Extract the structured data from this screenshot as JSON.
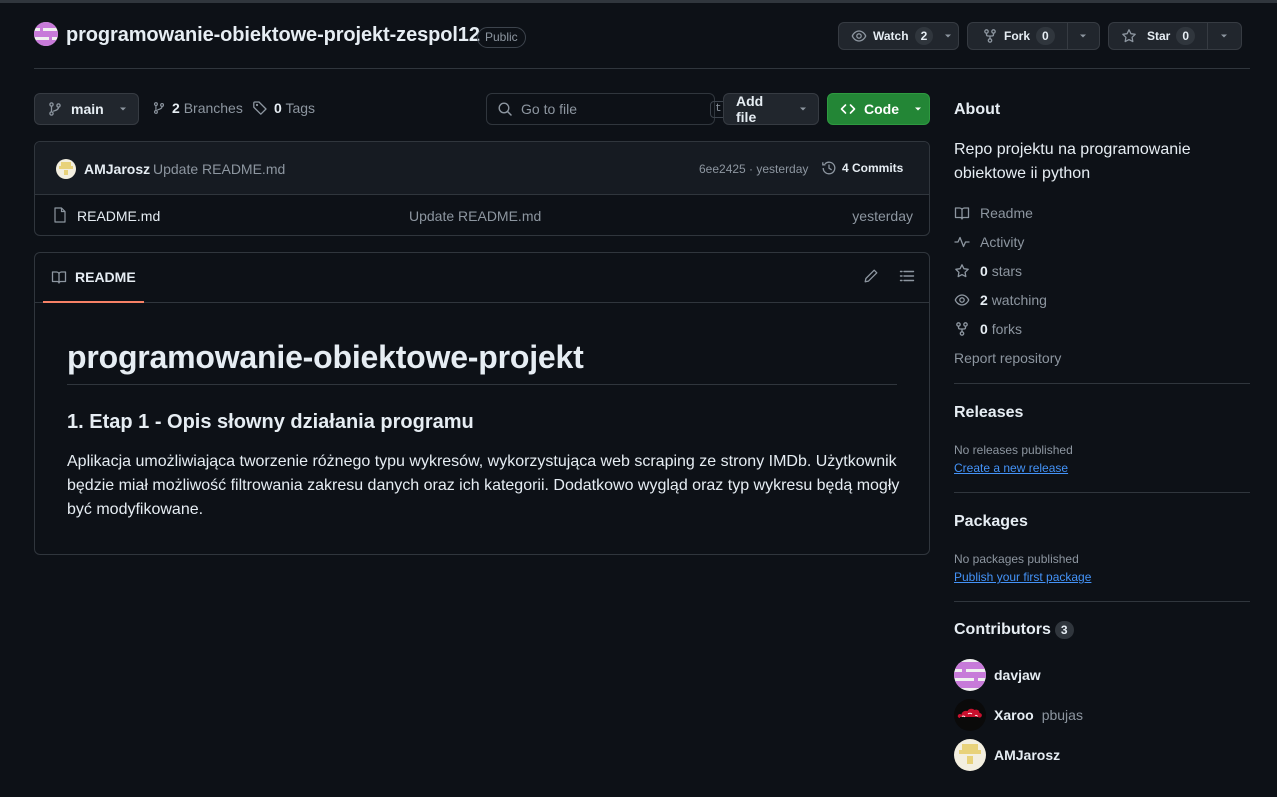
{
  "repo": {
    "name": "programowanie-obiektowe-projekt-zespol12",
    "visibility": "Public",
    "watch_label": "Watch",
    "watch_count": "2",
    "fork_label": "Fork",
    "fork_count": "0",
    "star_label": "Star",
    "star_count": "0"
  },
  "toolbar": {
    "branch": "main",
    "branches_count": "2",
    "branches_label": "Branches",
    "tags_count": "0",
    "tags_label": "Tags",
    "search_placeholder": "Go to file",
    "search_shortcut": "t",
    "add_file_label": "Add file",
    "code_label": "Code"
  },
  "commit": {
    "author": "AMJarosz",
    "message": "Update README.md",
    "sha_time": "6ee2425 · yesterday",
    "commits_label": "4 Commits"
  },
  "files": [
    {
      "name": "README.md",
      "message": "Update README.md",
      "date": "yesterday"
    }
  ],
  "readme": {
    "tab_label": "README",
    "h1": "programowanie-obiektowe-projekt",
    "h3": "1. Etap 1 - Opis słowny działania programu",
    "paragraph": "Aplikacja umożliwiająca tworzenie różnego typu wykresów, wykorzystująca web scraping ze strony IMDb. Użytkownik będzie miał możliwość filtrowania zakresu danych oraz ich kategorii. Dodatkowo wygląd oraz typ wykresu będą mogły być modyfikowane."
  },
  "about": {
    "heading": "About",
    "description": "Repo projektu na programowanie obiektowe ii python",
    "readme_label": "Readme",
    "activity_label": "Activity",
    "stars_count": "0",
    "stars_label": "stars",
    "watching_count": "2",
    "watching_label": "watching",
    "forks_count": "0",
    "forks_label": "forks",
    "report_label": "Report repository"
  },
  "releases": {
    "heading": "Releases",
    "empty_text": "No releases published",
    "link": "Create a new release"
  },
  "packages": {
    "heading": "Packages",
    "empty_text": "No packages published",
    "link": "Publish your first package"
  },
  "contributors": {
    "heading": "Contributors",
    "count": "3",
    "list": [
      {
        "name": "davjaw",
        "login": ""
      },
      {
        "name": "Xaroo",
        "login": "pbujas"
      },
      {
        "name": "AMJarosz",
        "login": ""
      }
    ]
  },
  "colors": {
    "background": "#0d1117",
    "accent_green": "#238636",
    "link_blue": "#4493f8",
    "tab_underline": "#f78166"
  }
}
